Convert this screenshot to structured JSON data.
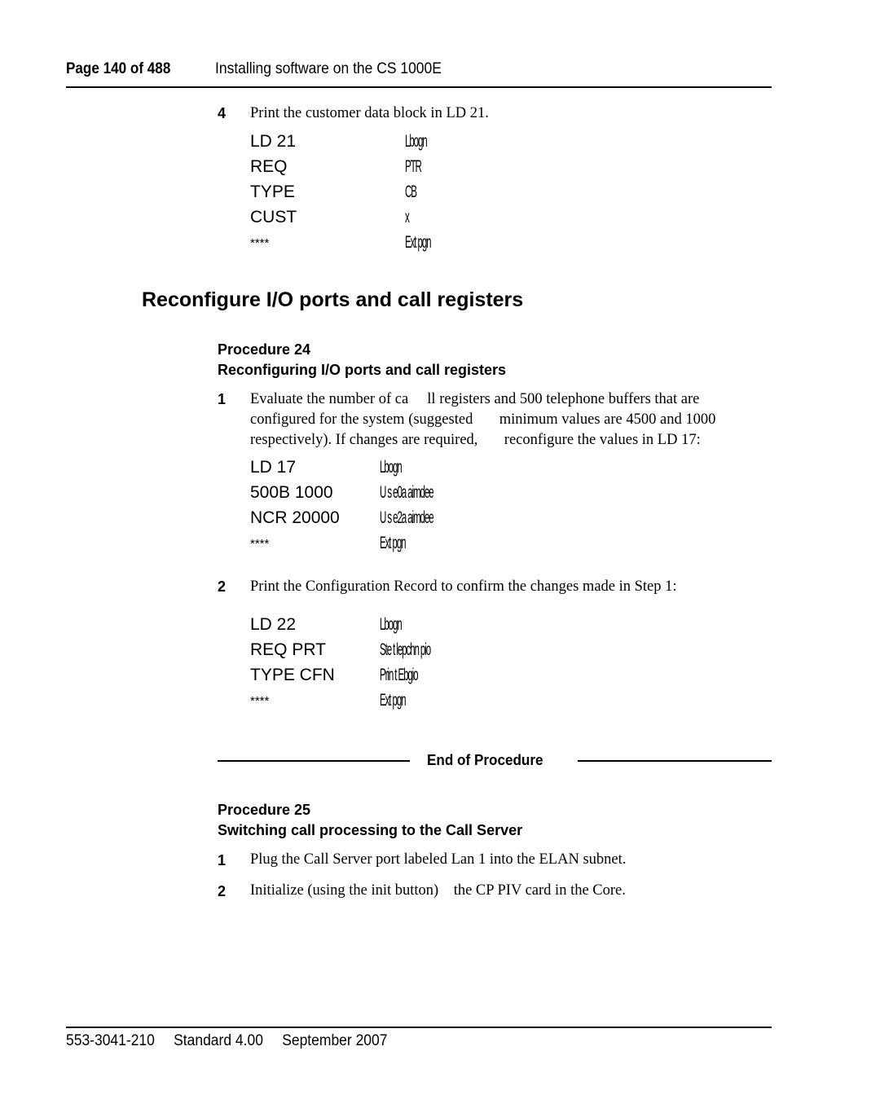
{
  "header": {
    "page_label": "Page 140 of 488",
    "section_title": "Installing software on the CS 1000E"
  },
  "step4": {
    "number": "4",
    "text": "Print the customer data block in LD 21.",
    "commands": [
      {
        "cmd": "LD 21",
        "desc": "Lbogn"
      },
      {
        "cmd": "REQ",
        "desc": "PTR"
      },
      {
        "cmd": "TYPE",
        "desc": "CB"
      },
      {
        "cmd": "CUST",
        "desc": "x"
      },
      {
        "cmd": "****",
        "desc": "Ext pgn"
      }
    ]
  },
  "section_heading": "Reconfigure I/O ports and call registers",
  "procedure24": {
    "label": "Procedure 24",
    "title": "Reconfiguring I/O ports and call registers",
    "step1": {
      "number": "1",
      "lines": [
        "Evaluate the number of ca     ll registers and 500 telephone buffers that are",
        "configured for the system (suggested       minimum values are 4500 and 1000",
        "respectively). If changes are required,       reconfigure the values in LD 17:"
      ],
      "commands": [
        {
          "cmd": "LD 17",
          "desc": "Lbogn"
        },
        {
          "cmd": "500B 1000",
          "desc": "U s e0a aimdee"
        },
        {
          "cmd": "NCR 20000",
          "desc": "U s e2a aimdee"
        },
        {
          "cmd": "****",
          "desc": "Ext pgn"
        }
      ]
    },
    "step2": {
      "number": "2",
      "text": "Print the Configuration Record to confirm the changes made in Step 1:",
      "commands": [
        {
          "cmd": "LD 22",
          "desc": "Lbogn"
        },
        {
          "cmd": "REQ PRT",
          "desc": "Ste t lepchn pio"
        },
        {
          "cmd": "TYPE CFN",
          "desc": "Prin t Ebgio"
        },
        {
          "cmd": "****",
          "desc": "Ext pgn"
        }
      ]
    },
    "end_label": "End of Procedure"
  },
  "procedure25": {
    "label": "Procedure 25",
    "title": "Switching call processing to the Call Server",
    "steps": [
      {
        "number": "1",
        "text": "Plug the Call Server port labeled Lan 1 into the ELAN subnet."
      },
      {
        "number": "2",
        "text": "Initialize (using the init button)    the CP PIV card in the Core."
      }
    ]
  },
  "footer": {
    "doc_number": "553-3041-210",
    "standard": "Standard 4.00",
    "date": "September 2007"
  }
}
